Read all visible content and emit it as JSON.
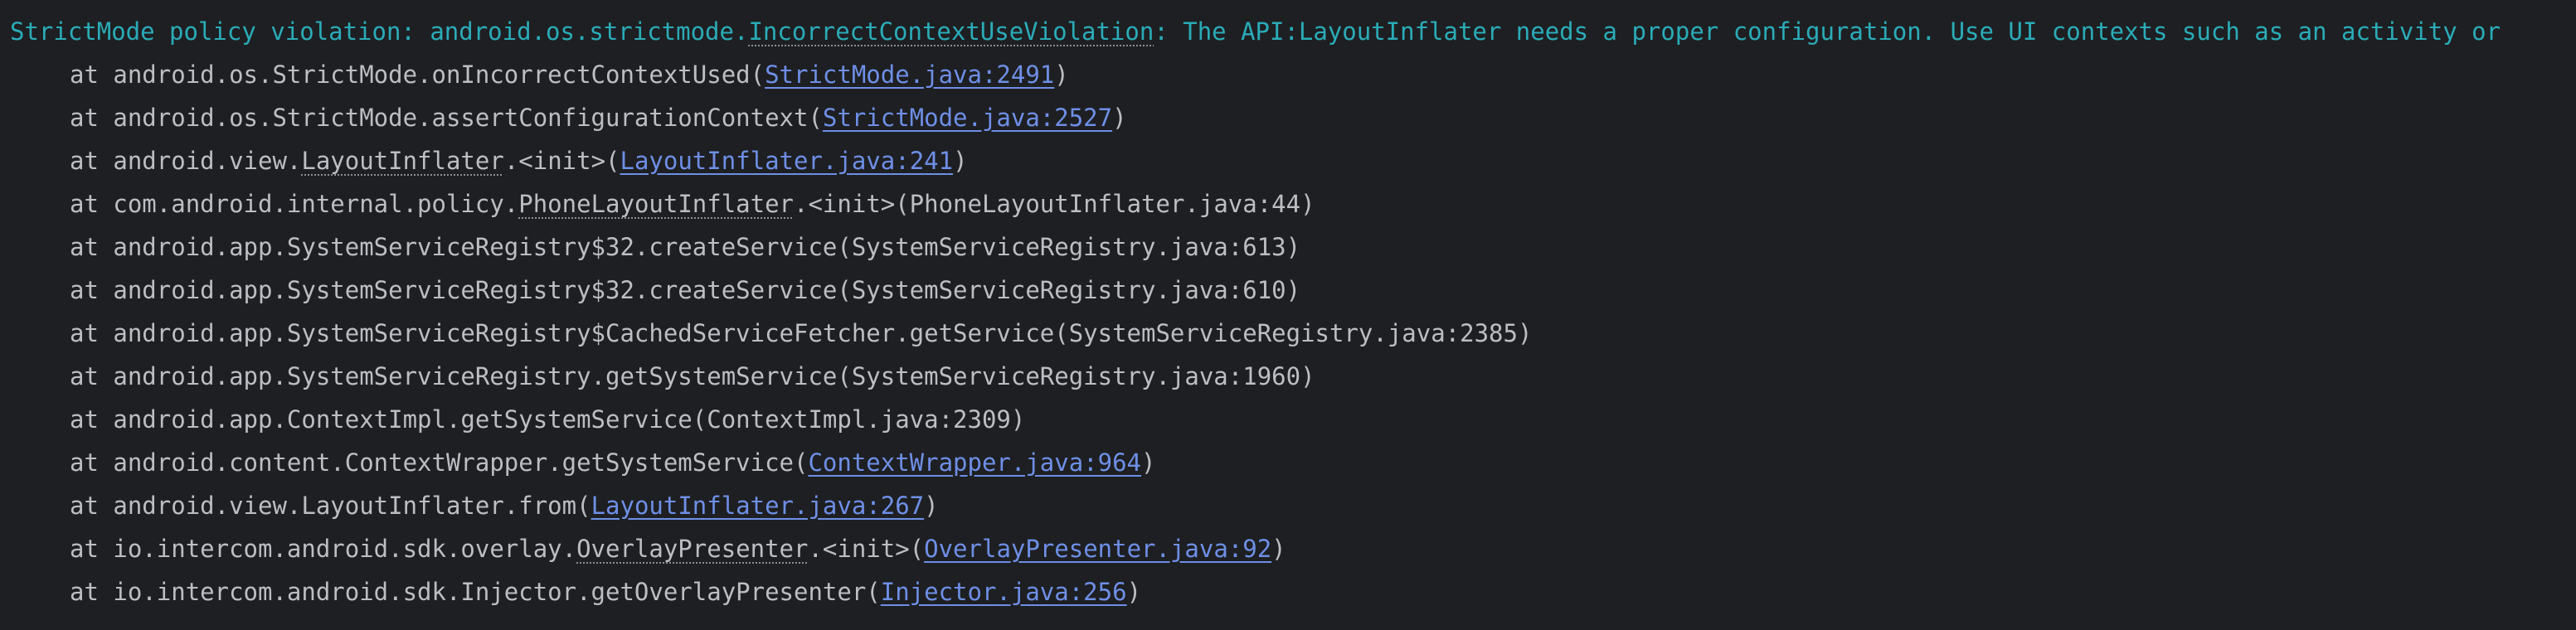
{
  "console": {
    "header": {
      "prefix": "StrictMode policy violation: android.os.strictmode.",
      "violation": "IncorrectContextUseViolation",
      "message": ": The API:LayoutInflater needs a proper configuration. Use UI contexts such as an activity or"
    },
    "frames": [
      {
        "at": "at ",
        "method": "android.os.StrictMode.onIncorrectContextUsed(",
        "loc": "StrictMode.java:2491",
        "tail": ")"
      },
      {
        "at": "at ",
        "method": "android.os.StrictMode.assertConfigurationContext(",
        "loc": "StrictMode.java:2527",
        "tail": ")"
      },
      {
        "at": "at ",
        "pre": "android.view.",
        "dotted": "LayoutInflater",
        "post": ".<init>(",
        "loc": "LayoutInflater.java:241",
        "tail": ")"
      },
      {
        "at": "at ",
        "pre": "com.android.internal.policy.",
        "dotted": "PhoneLayoutInflater",
        "post": ".<init>(PhoneLayoutInflater.java:44)"
      },
      {
        "at": "at ",
        "text": "android.app.SystemServiceRegistry$32.createService(SystemServiceRegistry.java:613)"
      },
      {
        "at": "at ",
        "text": "android.app.SystemServiceRegistry$32.createService(SystemServiceRegistry.java:610)"
      },
      {
        "at": "at ",
        "text": "android.app.SystemServiceRegistry$CachedServiceFetcher.getService(SystemServiceRegistry.java:2385)"
      },
      {
        "at": "at ",
        "text": "android.app.SystemServiceRegistry.getSystemService(SystemServiceRegistry.java:1960)"
      },
      {
        "at": "at ",
        "text": "android.app.ContextImpl.getSystemService(ContextImpl.java:2309)"
      },
      {
        "at": "at ",
        "method": "android.content.ContextWrapper.getSystemService(",
        "loc": "ContextWrapper.java:964",
        "tail": ")"
      },
      {
        "at": "at ",
        "method": "android.view.LayoutInflater.from(",
        "loc": "LayoutInflater.java:267",
        "tail": ")"
      },
      {
        "at": "at ",
        "pre": "io.intercom.android.sdk.overlay.",
        "dotted": "OverlayPresenter",
        "post": ".<init>(",
        "loc": "OverlayPresenter.java:92",
        "tail": ")"
      },
      {
        "at": "at ",
        "method": "io.intercom.android.sdk.Injector.getOverlayPresenter(",
        "loc": "Injector.java:256",
        "tail": ")"
      }
    ]
  },
  "colors": {
    "background": "#1e1f22",
    "text": "#bcbec4",
    "header": "#2aacb8",
    "link": "#6e8fe6"
  }
}
